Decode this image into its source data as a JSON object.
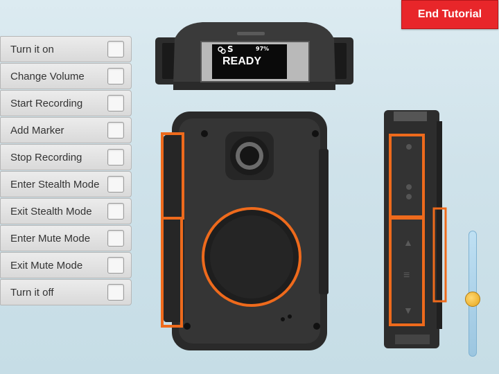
{
  "header": {
    "end_tutorial_label": "End Tutorial"
  },
  "tasks": [
    {
      "label": "Turn it on"
    },
    {
      "label": "Change Volume"
    },
    {
      "label": "Start Recording"
    },
    {
      "label": "Add Marker"
    },
    {
      "label": "Stop Recording"
    },
    {
      "label": "Enter Stealth Mode"
    },
    {
      "label": "Exit Stealth Mode"
    },
    {
      "label": "Enter Mute Mode"
    },
    {
      "label": "Exit Mute Mode"
    },
    {
      "label": "Turn it off"
    }
  ],
  "device": {
    "screen": {
      "status_letter": "S",
      "battery": "97%",
      "status_text": "READY"
    }
  },
  "volume_slider": {
    "level": 0.45
  },
  "colors": {
    "accent_orange": "#ee6a1c",
    "end_button": "#e8262a",
    "body": "#2f2f2f"
  }
}
